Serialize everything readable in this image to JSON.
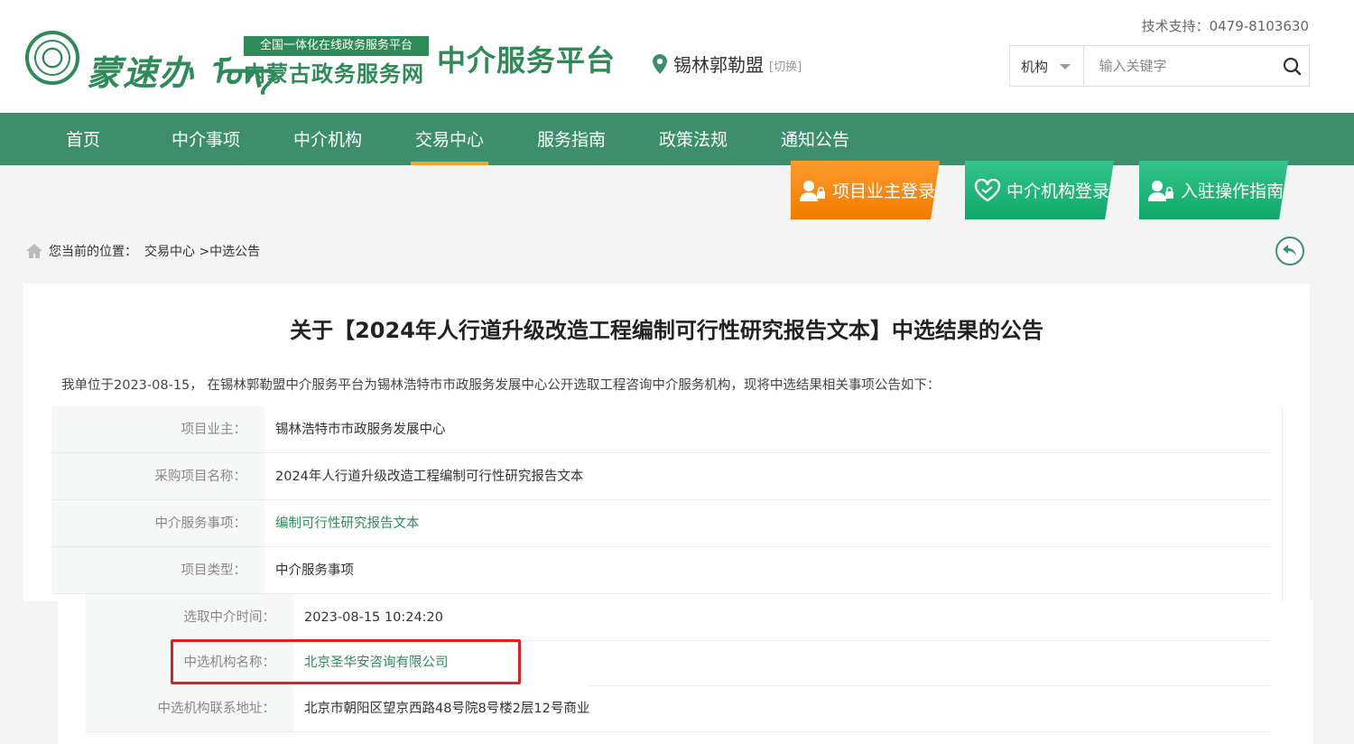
{
  "header": {
    "logo_script": "蒙速办 ᠮᠣᠩ",
    "logo_badge": "全国一体化在线政务服务平台",
    "logo_site": "内蒙古政务服务网",
    "platform_title": "中介服务平台",
    "location": "锡林郭勒盟",
    "location_switch": "[切换]",
    "tech_support": "技术支持：0479-8103630",
    "search_type": "机构",
    "search_placeholder": "输入关键字"
  },
  "nav": {
    "items": [
      {
        "label": "首页"
      },
      {
        "label": "中介事项"
      },
      {
        "label": "中介机构"
      },
      {
        "label": "交易中心"
      },
      {
        "label": "服务指南"
      },
      {
        "label": "政策法规"
      },
      {
        "label": "通知公告"
      }
    ],
    "active": "交易中心"
  },
  "logins": {
    "owner": "项目业主登录",
    "agency": "中介机构登录",
    "guide": "入驻操作指南"
  },
  "breadcrumb": {
    "prefix": "您当前的位置：",
    "path": "交易中心 >中选公告"
  },
  "article": {
    "title": "关于【2024年人行道升级改造工程编制可行性研究报告文本】中选结果的公告",
    "intro": "我单位于2023-08-15， 在锡林郭勒盟中介服务平台为锡林浩特市市政服务发展中心公开选取工程咨询中介服务机构，现将中选结果相关事项公告如下：",
    "rows": [
      {
        "label": "项目业主：",
        "value": "锡林浩特市市政服务发展中心"
      },
      {
        "label": "采购项目名称：",
        "value": "2024年人行道升级改造工程编制可行性研究报告文本"
      },
      {
        "label": "中介服务事项：",
        "value": "编制可行性研究报告文本"
      },
      {
        "label": "项目类型：",
        "value": "中介服务事项"
      },
      {
        "label": "选取中介时间：",
        "value": "2023-08-15 10:24:20"
      },
      {
        "label": "中选机构名称：",
        "value": "北京圣华安咨询有限公司"
      },
      {
        "label": "中选机构联系地址：",
        "value": "北京市朝阳区望京西路48号院8号楼2层12号商业"
      }
    ]
  },
  "colors": {
    "brand_green": "#3c8f6a",
    "accent_orange": "#f5a623",
    "highlight_red": "#e02020"
  }
}
